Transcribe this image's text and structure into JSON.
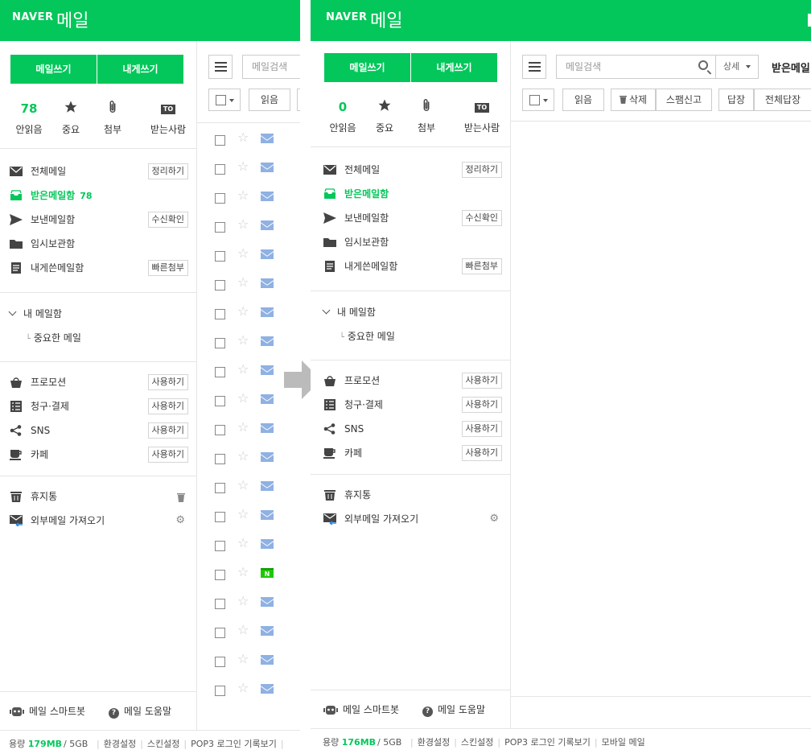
{
  "colors": {
    "brand": "#03c75a",
    "envelope": "#8fb1e3",
    "arrow": "#bbbbbb"
  },
  "before": {
    "header": {
      "logo": "NAVER",
      "service": "메일"
    },
    "write_buttons": [
      "메일쓰기",
      "내게쓰기"
    ],
    "quick": [
      {
        "value": "78",
        "label": "안읽음"
      },
      {
        "icon": "star-icon",
        "label": "중요"
      },
      {
        "icon": "paperclip-icon",
        "label": "첨부"
      },
      {
        "badge": "TO",
        "label": "받는사람"
      }
    ],
    "folders": [
      {
        "icon": "envelope-icon",
        "label": "전체메일",
        "action": "정리하기"
      },
      {
        "icon": "inbox-icon",
        "label": "받은메일함",
        "count": "78",
        "active": true
      },
      {
        "icon": "send-icon",
        "label": "보낸메일함",
        "action": "수신확인"
      },
      {
        "icon": "folder-icon",
        "label": "임시보관함"
      },
      {
        "icon": "note-icon",
        "label": "내게쓴메일함",
        "action": "빠른첨부"
      }
    ],
    "my_mailbox": {
      "label": "내 메일함",
      "sub": "중요한 메일"
    },
    "categories": [
      {
        "icon": "shopping-bag-icon",
        "label": "프로모션",
        "action": "사용하기"
      },
      {
        "icon": "receipt-icon",
        "label": "청구·결제",
        "action": "사용하기"
      },
      {
        "icon": "share-icon",
        "label": "SNS",
        "action": "사용하기"
      },
      {
        "icon": "cup-icon",
        "label": "카페",
        "action": "사용하기"
      }
    ],
    "tools": [
      {
        "icon": "trash-icon",
        "label": "휴지통"
      },
      {
        "icon": "import-mail-icon",
        "label": "외부메일 가져오기"
      }
    ],
    "bottom": {
      "smartbot": "메일 스마트봇",
      "help": "메일 도움말"
    },
    "footer": {
      "capacity_label": "용량",
      "used": "179MB",
      "total": "/ 5GB",
      "links": [
        "환경설정",
        "스킨설정",
        "POP3 로그인 기록보기"
      ]
    },
    "search": {
      "placeholder": "메일검색"
    },
    "toolbar": {
      "read": "읽음"
    },
    "mail_rows": [
      "env",
      "env",
      "env",
      "env",
      "env",
      "env",
      "env",
      "env",
      "env",
      "env",
      "env",
      "env",
      "env",
      "env",
      "env",
      "naver",
      "env",
      "env",
      "env",
      "env"
    ]
  },
  "after": {
    "header": {
      "logo": "NAVER",
      "service": "메일"
    },
    "write_buttons": [
      "메일쓰기",
      "내게쓰기"
    ],
    "quick": [
      {
        "value": "0",
        "label": "안읽음"
      },
      {
        "icon": "star-icon",
        "label": "중요"
      },
      {
        "icon": "paperclip-icon",
        "label": "첨부"
      },
      {
        "badge": "TO",
        "label": "받는사람"
      }
    ],
    "folders": [
      {
        "icon": "envelope-icon",
        "label": "전체메일",
        "action": "정리하기"
      },
      {
        "icon": "inbox-icon",
        "label": "받은메일함",
        "active": true
      },
      {
        "icon": "send-icon",
        "label": "보낸메일함",
        "action": "수신확인"
      },
      {
        "icon": "folder-icon",
        "label": "임시보관함"
      },
      {
        "icon": "note-icon",
        "label": "내게쓴메일함",
        "action": "빠른첨부"
      }
    ],
    "my_mailbox": {
      "label": "내 메일함",
      "sub": "중요한 메일"
    },
    "categories": [
      {
        "icon": "shopping-bag-icon",
        "label": "프로모션",
        "action": "사용하기"
      },
      {
        "icon": "receipt-icon",
        "label": "청구·결제",
        "action": "사용하기"
      },
      {
        "icon": "share-icon",
        "label": "SNS",
        "action": "사용하기"
      },
      {
        "icon": "cup-icon",
        "label": "카페",
        "action": "사용하기"
      }
    ],
    "tools": [
      {
        "icon": "trash-icon",
        "label": "휴지통"
      },
      {
        "icon": "import-mail-icon",
        "label": "외부메일 가져오기"
      }
    ],
    "bottom": {
      "smartbot": "메일 스마트봇",
      "help": "메일 도움말"
    },
    "footer": {
      "capacity_label": "용량",
      "used": "176MB",
      "total": "/ 5GB",
      "links": [
        "환경설정",
        "스킨설정",
        "POP3 로그인 기록보기",
        "모바일 메일"
      ]
    },
    "search": {
      "placeholder": "메일검색",
      "detail": "상세"
    },
    "mailbox_title": "받은메일",
    "toolbar": {
      "read": "읽음",
      "delete": "삭제",
      "spam": "스팸신고",
      "reply": "답장",
      "reply_all": "전체답장"
    }
  }
}
